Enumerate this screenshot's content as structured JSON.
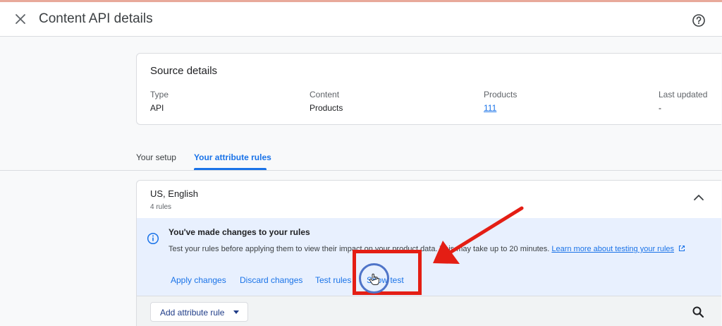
{
  "header": {
    "title": "Content API details",
    "close_icon": "close-icon",
    "help_icon": "help-icon"
  },
  "source_details": {
    "title": "Source details",
    "columns": [
      {
        "label": "Type",
        "value": "API"
      },
      {
        "label": "Content",
        "value": "Products"
      },
      {
        "label": "Products",
        "value": "111"
      },
      {
        "label": "Last updated",
        "value": "-"
      }
    ]
  },
  "tabs": [
    {
      "label": "Your setup",
      "active": false
    },
    {
      "label": "Your attribute rules",
      "active": true
    }
  ],
  "rules_section": {
    "title": "US, English",
    "count": "4 rules",
    "collapse_icon": "chevron-up-icon"
  },
  "notice": {
    "icon": "info-icon",
    "title": "You've made changes to your rules",
    "body": "Test your rules before applying them to view their impact on your product data. This may take up to 20 minutes.",
    "link_text": "Learn more about testing your rules",
    "link_icon": "external-link-icon",
    "actions": [
      "Apply changes",
      "Discard changes",
      "Test rules",
      "Show test"
    ]
  },
  "toolbar": {
    "add_rule_label": "Add attribute rule",
    "dropdown_icon": "caret-down-icon",
    "search_icon": "search-icon"
  },
  "annotation": {
    "highlight_color": "#e41e14",
    "cursor_ring_color": "#4f74c8",
    "arrow_icon": "red-arrow-icon",
    "cursor_icon": "hand-cursor-icon"
  },
  "colors": {
    "accent": "#1a73e8",
    "notice_bg": "#e8f0fe"
  }
}
